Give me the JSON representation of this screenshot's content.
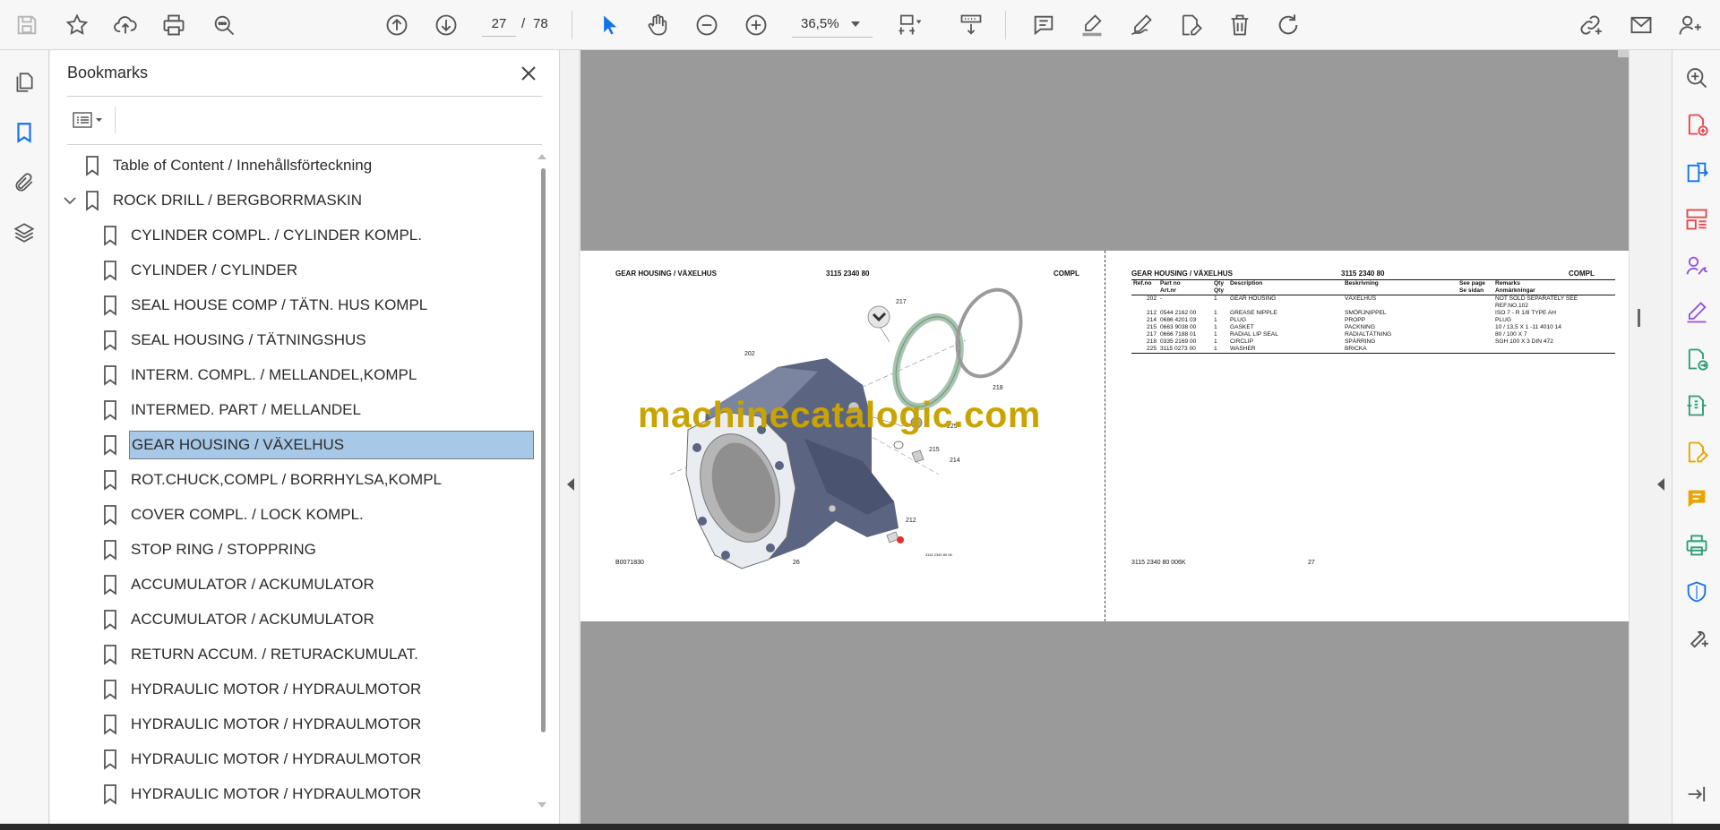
{
  "toolbar": {
    "page_current": "27",
    "page_separator": "/",
    "page_total": "78",
    "zoom": "36,5%",
    "icons": [
      "save-icon",
      "star-icon",
      "upload-icon",
      "print-icon",
      "find-icon",
      "page-up-icon",
      "page-down-icon",
      "select-cursor-icon",
      "hand-icon",
      "zoom-out-icon",
      "zoom-in-icon",
      "zoom-dropdown-icon",
      "fit-page-icon",
      "scroll-mode-icon",
      "comment-icon",
      "highlight-icon",
      "draw-icon",
      "edit-pdf-icon",
      "delete-icon",
      "rotate-icon",
      "share-link-icon",
      "email-icon",
      "account-icon"
    ]
  },
  "left_rail": {
    "icons": [
      "page-thumbnails-icon",
      "bookmarks-icon",
      "attachments-icon",
      "layers-icon"
    ]
  },
  "bookmarks": {
    "title": "Bookmarks",
    "items": [
      {
        "label": "Table of Content / Innehållsförteckning",
        "level": 0
      },
      {
        "label": "ROCK DRILL / BERGBORRMASKIN",
        "level": 0,
        "expanded": true
      },
      {
        "label": "CYLINDER COMPL.  / CYLINDER KOMPL.",
        "level": 1
      },
      {
        "label": "CYLINDER / CYLINDER",
        "level": 1
      },
      {
        "label": "SEAL HOUSE COMP  / TÄTN. HUS KOMPL",
        "level": 1
      },
      {
        "label": "SEAL HOUSING / TÄTNINGSHUS",
        "level": 1
      },
      {
        "label": "INTERM. COMPL. / MELLANDEL,KOMPL",
        "level": 1
      },
      {
        "label": "INTERMED. PART / MELLANDEL",
        "level": 1
      },
      {
        "label": "GEAR HOUSING / VÄXELHUS",
        "level": 1,
        "selected": true
      },
      {
        "label": "ROT.CHUCK,COMPL  / BORRHYLSA,KOMPL",
        "level": 1
      },
      {
        "label": "COVER COMPL. / LOCK KOMPL.",
        "level": 1
      },
      {
        "label": "STOP RING / STOPPRING",
        "level": 1
      },
      {
        "label": "ACCUMULATOR / ACKUMULATOR",
        "level": 1
      },
      {
        "label": "ACCUMULATOR / ACKUMULATOR",
        "level": 1
      },
      {
        "label": "RETURN ACCUM. / RETURACKUMULAT.",
        "level": 1
      },
      {
        "label": "HYDRAULIC MOTOR  / HYDRAULMOTOR",
        "level": 1
      },
      {
        "label": "HYDRAULIC MOTOR  / HYDRAULMOTOR",
        "level": 1
      },
      {
        "label": "HYDRAULIC MOTOR  / HYDRAULMOTOR",
        "level": 1
      },
      {
        "label": "HYDRAULIC MOTOR  / HYDRAULMOTOR",
        "level": 1
      }
    ]
  },
  "document": {
    "watermark": "machinecatalogic.com",
    "left_page": {
      "title": "GEAR HOUSING / VÄXELHUS",
      "part_no": "3115 2340 80",
      "type": "COMPL",
      "footer_left": "B0071830",
      "footer_page": "26",
      "footer_small": "3115 2340 80 06",
      "callouts": [
        "217",
        "202",
        "218",
        "225",
        "215",
        "214",
        "212"
      ]
    },
    "right_page": {
      "title": "GEAR HOUSING / VÄXELHUS",
      "part_no": "3115 2340 80",
      "type": "COMPL",
      "footer_left": "3115 2340 80 006K",
      "footer_page": "27",
      "table_headers_1": [
        "Ref.no",
        "Part no",
        "Qty",
        "Description",
        "Beskrivning",
        "See page",
        "Remarks"
      ],
      "table_headers_2": [
        "",
        "Art.nr",
        "Qty",
        "",
        "",
        "Se sidan",
        "Anmärkningar"
      ],
      "rows": [
        [
          "202",
          "-",
          "1",
          "GEAR HOUSING",
          "VÄXELHUS",
          "",
          "NOT SOLD SEPARATELY SEE"
        ],
        [
          "",
          "",
          "",
          "",
          "",
          "",
          "REF.NO.102"
        ],
        [
          "212",
          "0544 2162 00",
          "1",
          "GREASE NIPPLE",
          "SMÖRJNIPPEL",
          "",
          "ISO 7 - R 1/8 TYPE AH"
        ],
        [
          "214",
          "0686 4201 03",
          "1",
          "PLUG",
          "PROPP",
          "",
          "PLUG"
        ],
        [
          "215",
          "0663 9038 00",
          "1",
          "GASKET",
          "PACKNING",
          "",
          "10 / 13,5 X 1 -11 4010 14"
        ],
        [
          "217",
          "0666 7188 01",
          "1",
          "RADIAL LIP SEAL",
          "RADIALTÄTNING",
          "",
          "80 / 100 X 7"
        ],
        [
          "218",
          "0335 2169 00",
          "1",
          "CIRCLIP",
          "SPÄRRING",
          "",
          "SGH 100 X 3 DIN 472"
        ],
        [
          "225",
          "3115 0273 00",
          "1",
          "WASHER",
          "BRICKA",
          "",
          ""
        ]
      ]
    }
  },
  "right_rail": {
    "icons": [
      "search-enhance-icon",
      "create-pdf-icon",
      "export-pdf-icon",
      "organize-pages-icon",
      "request-signature-icon",
      "fill-sign-icon",
      "send-for-review-icon",
      "compress-pdf-icon",
      "edit-pdf-icon",
      "comment-icon",
      "print-production-icon",
      "protect-icon",
      "more-tools-icon",
      "collapse-rail-icon"
    ]
  },
  "colors": {
    "accent_blue": "#1473e6",
    "tool_red": "#e34850",
    "tool_purple": "#9256d9",
    "tool_green": "#2d9d78",
    "tool_yellow": "#e8a400",
    "selection": "#a7c8e6",
    "housing": "#5b6582",
    "watermark": "#c9a400"
  }
}
